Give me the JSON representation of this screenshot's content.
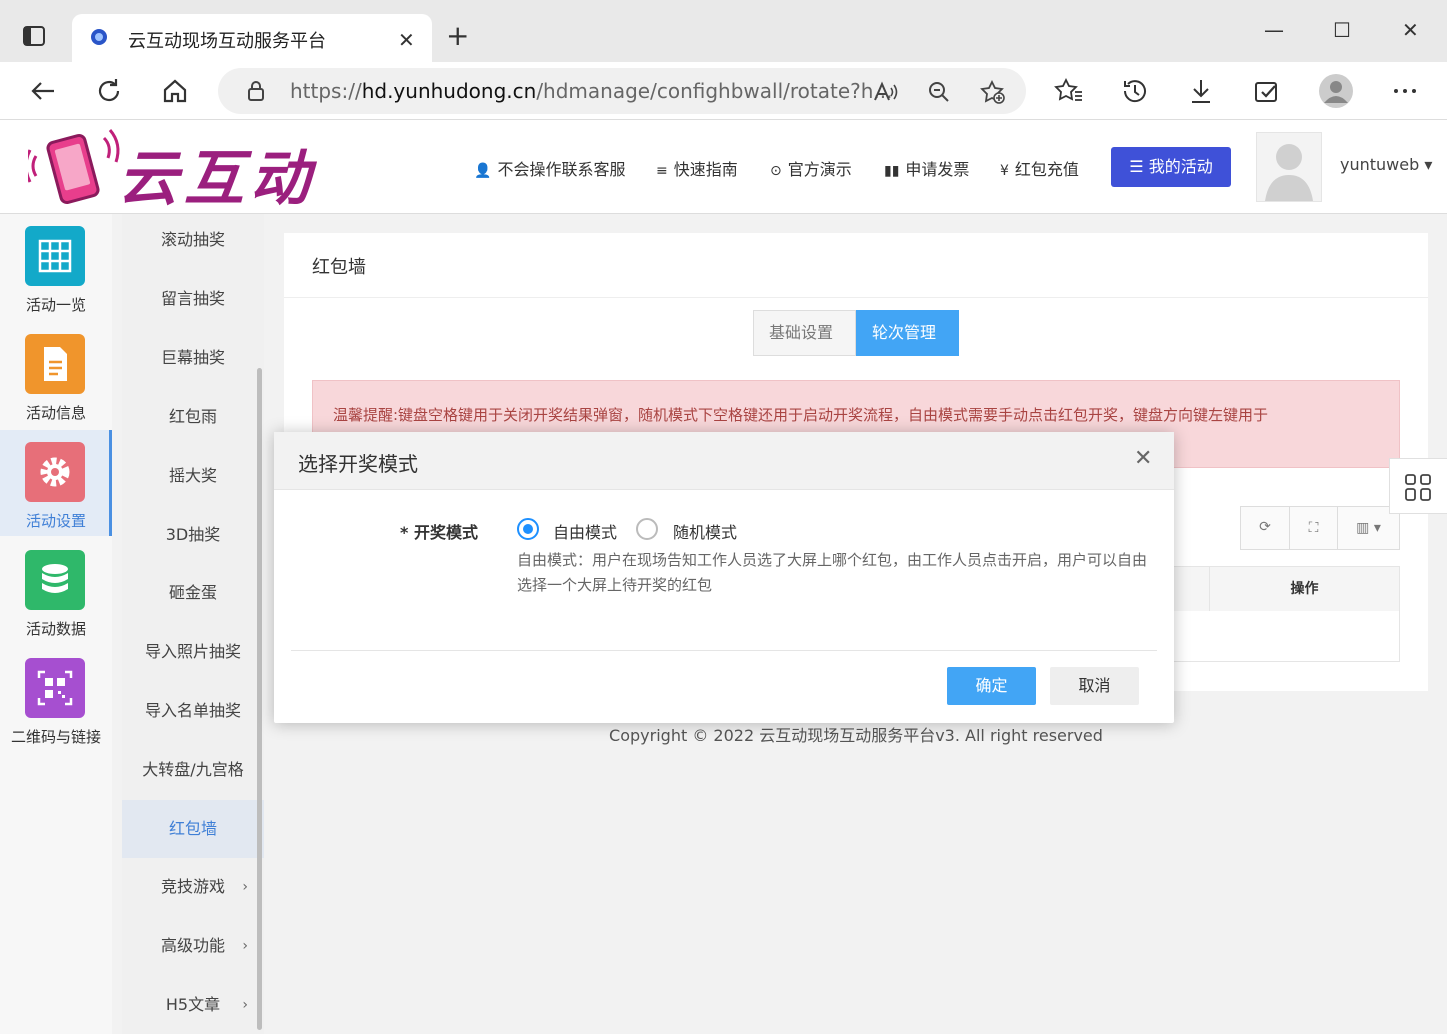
{
  "browser": {
    "tab_title": "云互动现场互动服务平台",
    "tab_close": "✕",
    "new_tab": "+",
    "url_prefix": "https://",
    "url_domain": "hd.yunhudong.cn",
    "url_path": "/hdmanage/confighbwall/rotate?h...",
    "win_min": "—",
    "win_max": "☐",
    "win_close": "✕"
  },
  "header": {
    "logo_text": "云互动",
    "nav": [
      {
        "icon": "👤",
        "label": "不会操作联系客服"
      },
      {
        "icon": "≡",
        "label": "快速指南"
      },
      {
        "icon": "⊙",
        "label": "官方演示"
      },
      {
        "icon": "▮▮",
        "label": "申请发票"
      },
      {
        "icon": "¥",
        "label": "红包充值"
      }
    ],
    "my_activity": "☰ 我的活动",
    "username": "yuntuweb ▾"
  },
  "sidebar": {
    "items": [
      {
        "label": "活动一览",
        "color": "#13a9c9",
        "icon": "grid-icon"
      },
      {
        "label": "活动信息",
        "color": "#f0952c",
        "icon": "document-icon"
      },
      {
        "label": "活动设置",
        "color": "#e76f79",
        "icon": "gear-icon"
      },
      {
        "label": "活动数据",
        "color": "#2fb86a",
        "icon": "database-icon"
      },
      {
        "label": "二维码与链接",
        "color": "#a64fd0",
        "icon": "qrcode-icon"
      }
    ]
  },
  "submenu": {
    "items": [
      {
        "label": "滚动抽奖"
      },
      {
        "label": "留言抽奖"
      },
      {
        "label": "巨幕抽奖"
      },
      {
        "label": "红包雨"
      },
      {
        "label": "摇大奖"
      },
      {
        "label": "3D抽奖"
      },
      {
        "label": "砸金蛋"
      },
      {
        "label": "导入照片抽奖"
      },
      {
        "label": "导入名单抽奖"
      },
      {
        "label": "大转盘/九宫格"
      },
      {
        "label": "红包墙"
      },
      {
        "label": "竞技游戏"
      },
      {
        "label": "高级功能"
      },
      {
        "label": "H5文章"
      }
    ],
    "chevron": "›"
  },
  "main": {
    "title": "红包墙",
    "tab_basic": "基础设置",
    "tab_rounds": "轮次管理",
    "alert": "温馨提醒:键盘空格键用于关闭开奖结果弹窗，随机模式下空格键还用于启动开奖流程，自由模式需要手动点击红包开奖，键盘方向键左键用于",
    "table_op_header": "操作",
    "tool_refresh": "⟳",
    "tool_fullscreen": "⛶",
    "tool_columns": "▥ ▾"
  },
  "footer": {
    "copyright": "Copyright © 2022 云互动现场互动服务平台v3. All right reserved"
  },
  "modal": {
    "title": "选择开奖模式",
    "close": "✕",
    "field_label": "* 开奖模式",
    "option_free": "自由模式",
    "option_random": "随机模式",
    "help": "自由模式：用户在现场告知工作人员选了大屏上哪个红包，由工作人员点击开启，用户可以自由选择一个大屏上待开奖的红包",
    "ok": "确定",
    "cancel": "取消"
  }
}
